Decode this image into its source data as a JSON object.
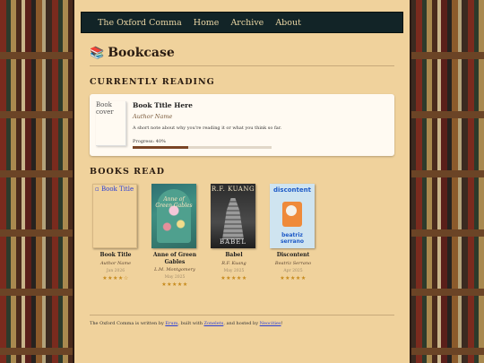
{
  "nav": {
    "brand": "The Oxford Comma",
    "home": "Home",
    "archive": "Archive",
    "about": "About"
  },
  "page": {
    "icon": "books-icon",
    "icon_glyph": "📚",
    "title": "Bookcase"
  },
  "current": {
    "heading": "CURRENTLY READING",
    "cover_alt": "Book cover",
    "title": "Book Title Here",
    "author": "Author Name",
    "note": "A short note about why you're reading it or what you think so far.",
    "progress_label": "Progress: 40%",
    "progress": 0.4
  },
  "read": {
    "heading": "BOOKS READ",
    "books": [
      {
        "cover_text": "Book Title",
        "title": "Book Title",
        "author": "Author Name",
        "date": "Jan 2026",
        "stars": "★★★★☆",
        "rating": 4
      },
      {
        "cover_text": "Anne of Green Gables",
        "title": "Anne of Green Gables",
        "author": "L.M. Montgomery",
        "date": "May 2025",
        "stars": "★★★★★",
        "rating": 5
      },
      {
        "cover_author": "R.F. KUANG",
        "cover_title": "BABEL",
        "title": "Babel",
        "author": "R.F. Kuang",
        "date": "May 2025",
        "stars": "★★★★★",
        "rating": 5
      },
      {
        "cover_top": "discontent",
        "cover_bottom": "beatriz serrano",
        "title": "Discontent",
        "author": "Beatriz Serrano",
        "date": "Apr 2025",
        "stars": "★★★★★",
        "rating": 5
      }
    ]
  },
  "footer": {
    "prefix": "The Oxford Comma is written by ",
    "author_link": "Erum",
    "mid1": ", built with ",
    "built_link": "Zonelets",
    "mid2": ", and hosted by ",
    "host_link": "Neocities",
    "suffix": "!"
  },
  "colors": {
    "page_bg": "#f0d29c",
    "nav_bg": "#122427",
    "progress_fill": "#7a4526",
    "star": "#c68a1c"
  }
}
